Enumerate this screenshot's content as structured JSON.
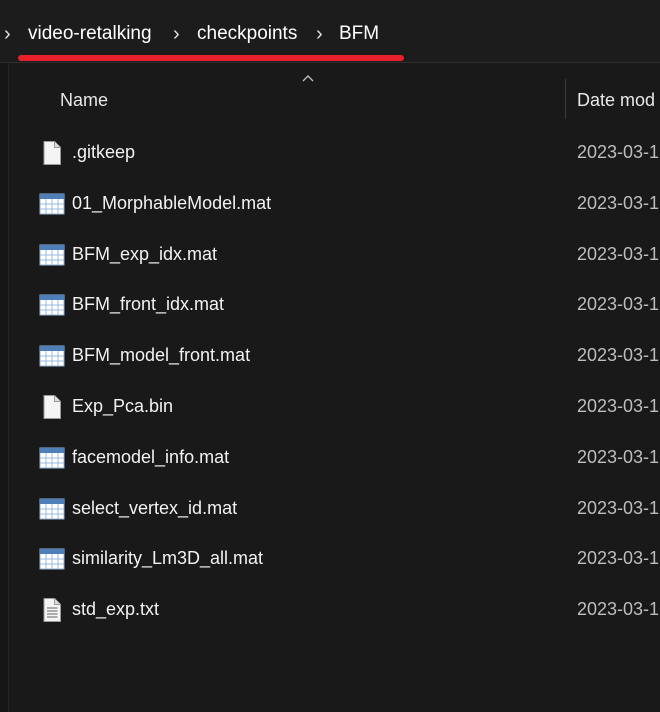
{
  "breadcrumb": {
    "items": [
      "video-retalking",
      "checkpoints",
      "BFM"
    ],
    "separator": "›"
  },
  "header": {
    "name_label": "Name",
    "date_label": "Date mod"
  },
  "files": [
    {
      "name": ".gitkeep",
      "date": "2023-03-1",
      "icon": "blank-file-icon"
    },
    {
      "name": "01_MorphableModel.mat",
      "date": "2023-03-1",
      "icon": "table-file-icon"
    },
    {
      "name": "BFM_exp_idx.mat",
      "date": "2023-03-1",
      "icon": "table-file-icon"
    },
    {
      "name": "BFM_front_idx.mat",
      "date": "2023-03-1",
      "icon": "table-file-icon"
    },
    {
      "name": "BFM_model_front.mat",
      "date": "2023-03-1",
      "icon": "table-file-icon"
    },
    {
      "name": "Exp_Pca.bin",
      "date": "2023-03-1",
      "icon": "blank-file-icon"
    },
    {
      "name": "facemodel_info.mat",
      "date": "2023-03-1",
      "icon": "table-file-icon"
    },
    {
      "name": "select_vertex_id.mat",
      "date": "2023-03-1",
      "icon": "table-file-icon"
    },
    {
      "name": "similarity_Lm3D_all.mat",
      "date": "2023-03-1",
      "icon": "table-file-icon"
    },
    {
      "name": "std_exp.txt",
      "date": "2023-03-1",
      "icon": "text-file-icon"
    }
  ],
  "colors": {
    "background": "#191919",
    "underline": "#e8202b",
    "text": "#ffffff"
  }
}
